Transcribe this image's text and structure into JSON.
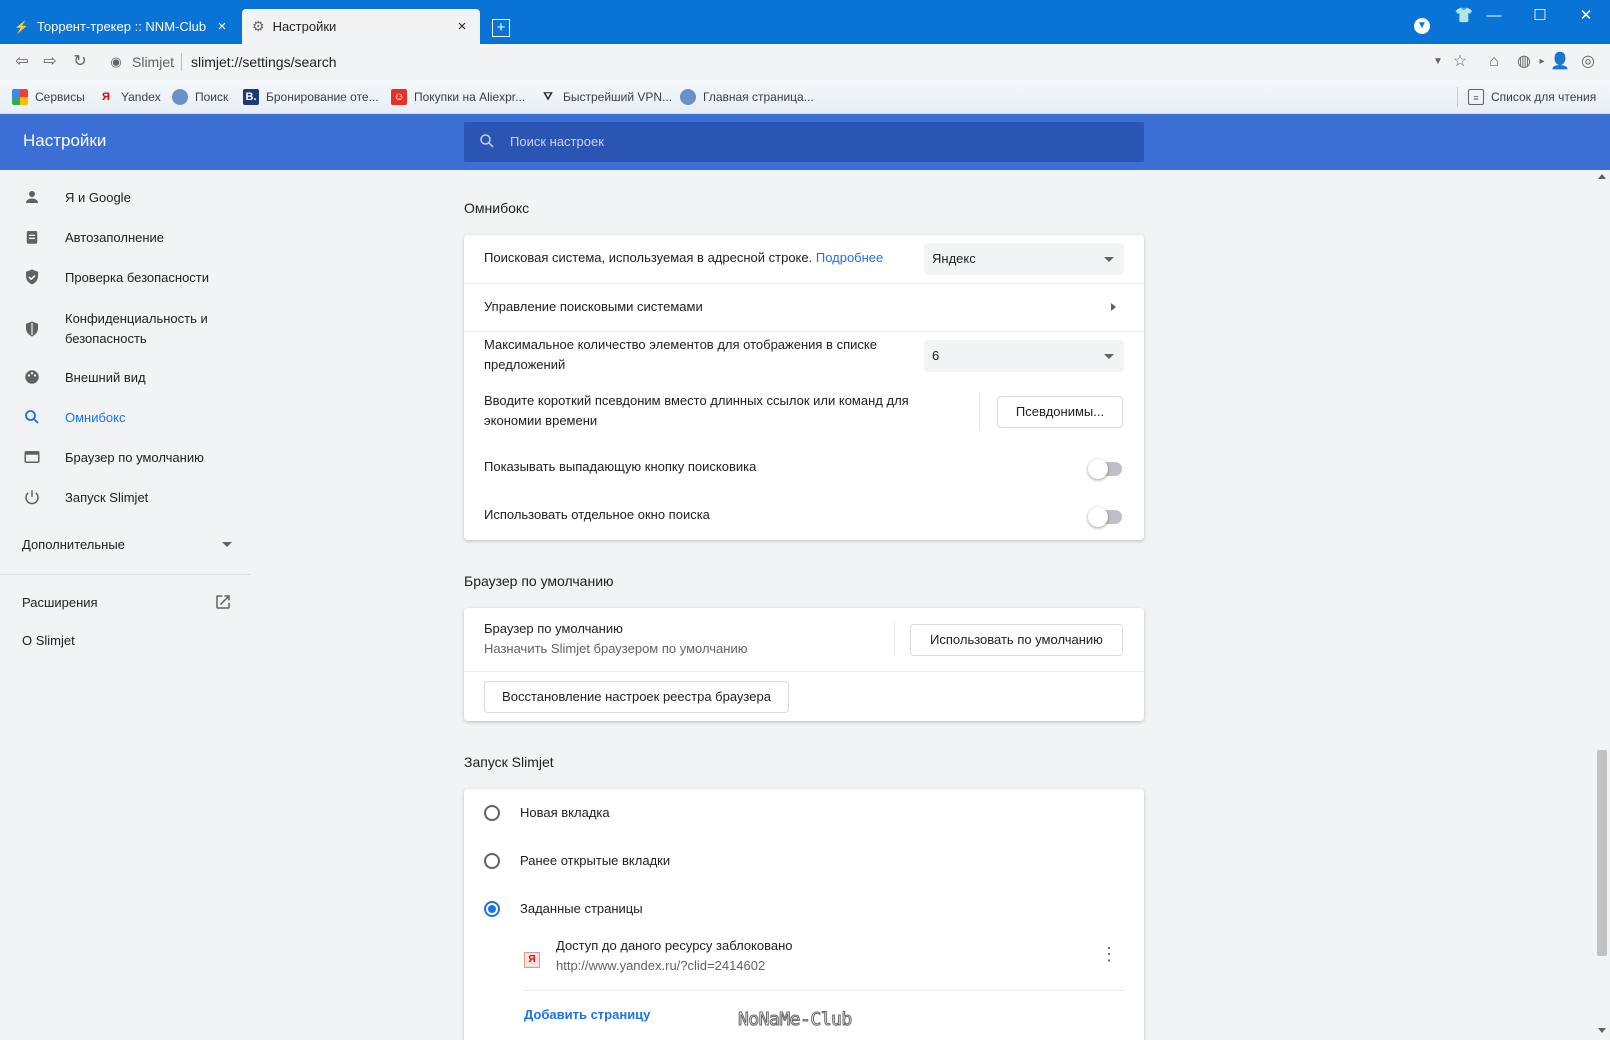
{
  "tabs": [
    {
      "label": "Торрент-трекер :: NNM-Club",
      "close": "×"
    },
    {
      "label": "Настройки",
      "close": "×"
    }
  ],
  "new_tab": "+",
  "window_controls": {
    "minimize": "—",
    "maximize": "☐",
    "close": "✕"
  },
  "toolbar": {
    "site_name": "Slimjet",
    "url": "slimjet://settings/search"
  },
  "bookmarks": [
    {
      "label": "Сервисы",
      "icon": "apps-grid-icon"
    },
    {
      "label": "Yandex",
      "icon": "yandex-icon"
    },
    {
      "label": "Поиск",
      "icon": "globe-icon"
    },
    {
      "label": "Бронирование оте...",
      "icon": "booking-icon"
    },
    {
      "label": "Покупки на Aliexpr...",
      "icon": "aliexpress-icon"
    },
    {
      "label": "Быстрейший VPN...",
      "icon": "vpn-icon"
    },
    {
      "label": "Главная страница...",
      "icon": "globe-icon"
    }
  ],
  "reading_list": "Список для чтения",
  "header": {
    "title": "Настройки",
    "search_placeholder": "Поиск настроек"
  },
  "sidebar": {
    "items": [
      {
        "label": "Я и Google",
        "icon": "person-icon"
      },
      {
        "label": "Автозаполнение",
        "icon": "clipboard-icon"
      },
      {
        "label": "Проверка безопасности",
        "icon": "shield-check-icon"
      },
      {
        "label": "Конфиденциальность и безопасность",
        "icon": "shield-icon"
      },
      {
        "label": "Внешний вид",
        "icon": "palette-icon"
      },
      {
        "label": "Омнибокс",
        "icon": "search-icon"
      },
      {
        "label": "Браузер по умолчанию",
        "icon": "browser-window-icon"
      },
      {
        "label": "Запуск Slimjet",
        "icon": "power-icon"
      }
    ],
    "advanced": "Дополнительные",
    "extensions": "Расширения",
    "about": "О Slimjet"
  },
  "omnibox": {
    "title": "Омнибокс",
    "search_engine_label": "Поисковая система, используемая в адресной строке.",
    "learn_more": "Подробнее",
    "search_engine_value": "Яндекс",
    "manage_engines": "Управление поисковыми системами",
    "max_items_label": "Максимальное количество элементов для отображения в списке предложений",
    "max_items_value": "6",
    "alias_label": "Вводите короткий псевдоним вместо длинных ссылок или команд для экономии времени",
    "alias_button": "Псевдонимы...",
    "show_dropdown_label": "Показывать выпадающую кнопку поисковика",
    "separate_window_label": "Использовать отдельное окно поиска"
  },
  "default_browser": {
    "title": "Браузер по умолчанию",
    "row_title": "Браузер по умолчанию",
    "row_subtitle": "Назначить Slimjet браузером по умолчанию",
    "make_default": "Использовать по умолчанию",
    "restore_registry": "Восстановление настроек реестра браузера"
  },
  "startup": {
    "title": "Запуск Slimjet",
    "options": [
      "Новая вкладка",
      "Ранее открытые вкладки",
      "Заданные страницы"
    ],
    "selected": 2,
    "page_title": "Доступ до даного ресурсу заблоковано",
    "page_url": "http://www.yandex.ru/?clid=2414602",
    "add_page": "Добавить страницу"
  },
  "watermark": "NoNaMe-Club",
  "colors": {
    "accent": "#1a73e8",
    "header": "#3b6fd6",
    "titlebar": "#0a74d6"
  }
}
